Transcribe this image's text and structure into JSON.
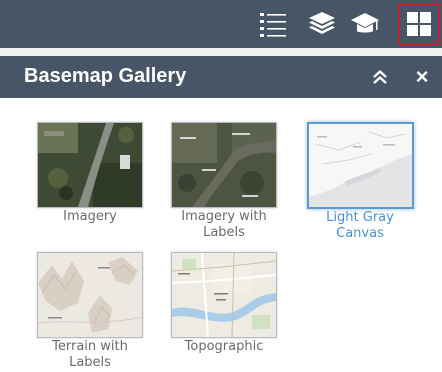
{
  "toolbar": {
    "buttons": [
      {
        "icon": "legend-icon"
      },
      {
        "icon": "layers-icon"
      },
      {
        "icon": "graduation-cap-icon"
      },
      {
        "icon": "basemap-gallery-icon",
        "active": true
      }
    ],
    "background": "#485566",
    "active_border": "#c0262c"
  },
  "panel": {
    "title": "Basemap Gallery",
    "collapse_icon": "double-chevron-up-icon",
    "close_label": "×"
  },
  "gallery": {
    "items": [
      {
        "label": "Imagery",
        "selected": false
      },
      {
        "label": "Imagery with Labels",
        "selected": false
      },
      {
        "label": "Light Gray Canvas",
        "selected": true
      },
      {
        "label": "Terrain with Labels",
        "selected": false
      },
      {
        "label": "Topographic",
        "selected": false
      }
    ],
    "selected_color": "#4a90d9"
  }
}
